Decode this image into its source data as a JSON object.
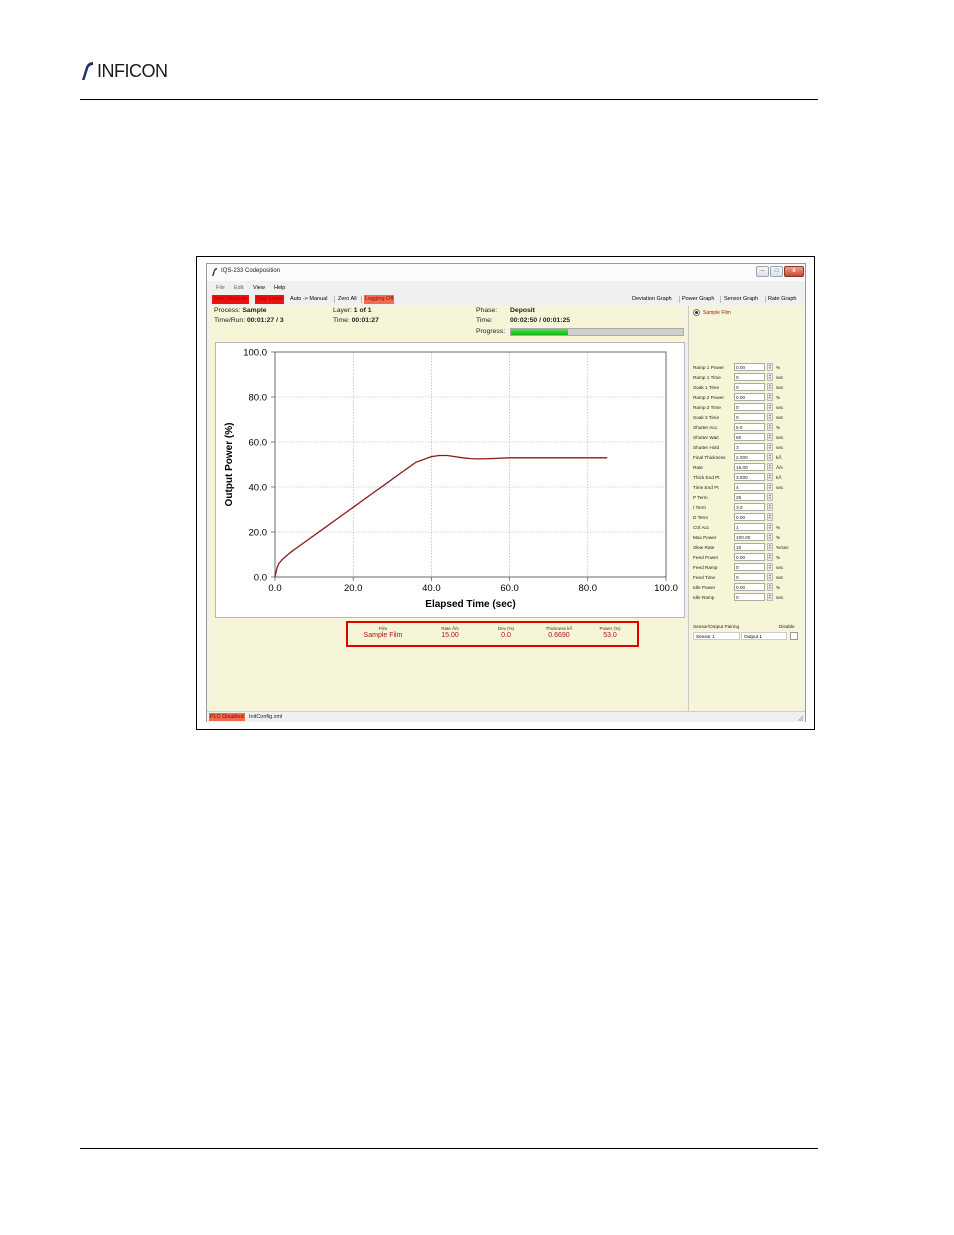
{
  "brand": {
    "logo_text": "INFICON"
  },
  "window": {
    "title": "IQS-233 Codeposition",
    "controls": {
      "minimize": "–",
      "maximize": "□",
      "close": "x"
    }
  },
  "menu": [
    "File",
    "Edit",
    "View",
    "Help"
  ],
  "toolbar": {
    "start_simulate": "Start Simulate",
    "stop_layer": "Stop Layer",
    "auto_manual": "Auto -> Manual",
    "zero_all": "Zero All",
    "logging": "Logging Off",
    "deviation_graph": "Deviation Graph",
    "power_graph": "Power Graph",
    "sensor_graph": "Sensor Graph",
    "rate_graph": "Rate Graph"
  },
  "status": {
    "process_label": "Process:",
    "process_value": "Sample",
    "timerun_label": "Time/Run:",
    "timerun_value": "00:01:27 / 3",
    "layer_label": "Layer:",
    "layer_value": "1 of 1",
    "time_label": "Time:",
    "time_value": "00:01:27",
    "phase_label": "Phase:",
    "phase_value": "Deposit",
    "phase_time_label": "Time:",
    "phase_time_value": "00:02:50 / 00:01:25",
    "progress_label": "Progress:",
    "progress_fraction": 0.33
  },
  "chart_data": {
    "type": "line",
    "xlabel": "Elapsed Time (sec)",
    "ylabel": "Output Power (%)",
    "xlim": [
      0,
      100
    ],
    "ylim": [
      0,
      100
    ],
    "xticks": [
      "0.0",
      "20.0",
      "40.0",
      "60.0",
      "80.0",
      "100.0"
    ],
    "yticks": [
      "0.0",
      "20.0",
      "40.0",
      "60.0",
      "80.0",
      "100.0"
    ],
    "grid": true,
    "line_color": "#8b1a1a",
    "series": [
      {
        "x": [
          0,
          0.5,
          1,
          2,
          4,
          8,
          12,
          16,
          20,
          24,
          28,
          32,
          36,
          40,
          42,
          44,
          46,
          48,
          50,
          52,
          55,
          60,
          65,
          70,
          75,
          80,
          85
        ],
        "y": [
          0,
          4,
          6,
          8,
          11,
          16,
          21,
          26,
          31,
          36,
          41,
          46,
          51,
          53.5,
          54,
          54,
          53.5,
          53,
          52.6,
          52.5,
          52.6,
          53,
          53,
          53,
          53,
          53,
          53
        ]
      }
    ]
  },
  "summary": {
    "headers": {
      "film": "Film",
      "rate": "Rate Å/s",
      "dev": "Dev (%)",
      "thickness": "Thickness kÅ",
      "power": "Power (%)"
    },
    "values": {
      "film": "Sample Film",
      "rate": "15.00",
      "dev": "0.0",
      "thickness": "0.6690",
      "power": "53.0"
    }
  },
  "sidebar": {
    "film_radio": "Sample Film",
    "params": [
      {
        "label": "Ramp 1 Power",
        "value": "0.00",
        "unit": "%"
      },
      {
        "label": "Ramp 1 Time",
        "value": "0",
        "unit": "sec"
      },
      {
        "label": "Soak 1 Time",
        "value": "0",
        "unit": "sec"
      },
      {
        "label": "Ramp 2 Power",
        "value": "0.00",
        "unit": "%"
      },
      {
        "label": "Ramp 2 Time",
        "value": "0",
        "unit": "sec"
      },
      {
        "label": "Soak 2 Time",
        "value": "0",
        "unit": "sec"
      },
      {
        "label": "Shutter Acc.",
        "value": "5.0",
        "unit": "%"
      },
      {
        "label": "Shutter Wait",
        "value": "60",
        "unit": "sec"
      },
      {
        "label": "Shutter Hold",
        "value": "3",
        "unit": "sec"
      },
      {
        "label": "Final Thickness",
        "value": "2.000",
        "unit": "kÅ"
      },
      {
        "label": "Rate",
        "value": "15.00",
        "unit": "Å/s"
      },
      {
        "label": "Thick End Pt",
        "value": "3.000",
        "unit": "kÅ"
      },
      {
        "label": "Time End Pt",
        "value": "4",
        "unit": "sec"
      },
      {
        "label": "P Term",
        "value": "25",
        "unit": ""
      },
      {
        "label": "I Term",
        "value": "3.0",
        "unit": ""
      },
      {
        "label": "D Term",
        "value": "0.00",
        "unit": ""
      },
      {
        "label": "Ctrl Acc",
        "value": "1",
        "unit": "%"
      },
      {
        "label": "Max Power",
        "value": "100.00",
        "unit": "%"
      },
      {
        "label": "Slew Rate",
        "value": "10",
        "unit": "%/sec"
      },
      {
        "label": "Feed Power",
        "value": "0.00",
        "unit": "%"
      },
      {
        "label": "Feed Ramp",
        "value": "0",
        "unit": "sec"
      },
      {
        "label": "Feed Time",
        "value": "0",
        "unit": "sec"
      },
      {
        "label": "Idle Power",
        "value": "0.00",
        "unit": "%"
      },
      {
        "label": "Idle Ramp",
        "value": "0",
        "unit": "sec"
      }
    ],
    "pairing_header": "Sensor/Output Pairing",
    "disable_header": "Disable",
    "sensor": "Sensor 1",
    "output": "Output 1"
  },
  "statusbar": {
    "plc": "PLC Disabled",
    "config": "InitConfig.xml"
  }
}
